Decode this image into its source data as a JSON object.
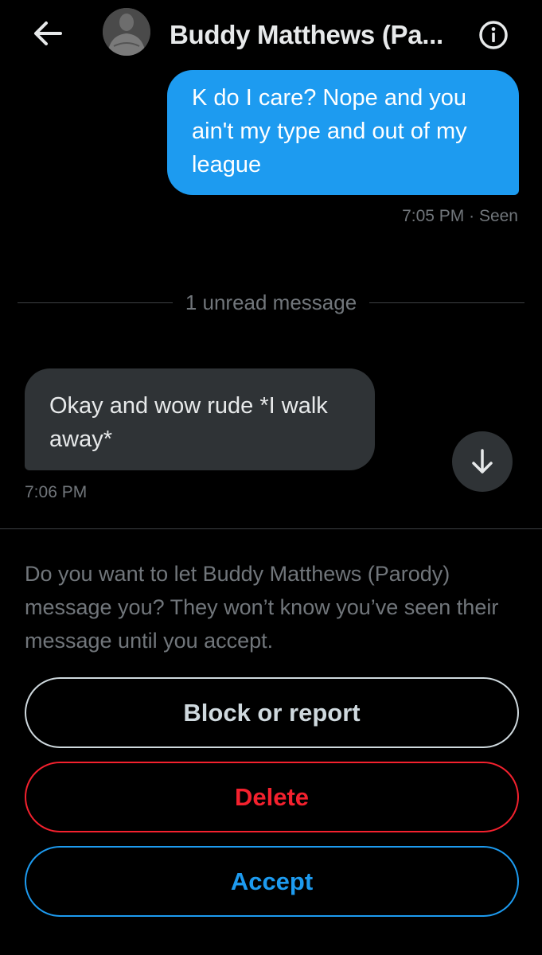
{
  "header": {
    "back_icon": "arrow-left-icon",
    "contact_name": "Buddy Matthews (Pa...",
    "info_icon": "info-circle-icon"
  },
  "messages": {
    "outgoing": {
      "text": "K do I care? Nope and you ain't my type and out of my league",
      "meta": "7:05 PM · Seen"
    },
    "unread_divider": "1 unread message",
    "incoming": {
      "text": "Okay and wow rude *I walk away*",
      "meta": "7:06 PM"
    },
    "scroll_icon": "arrow-down-icon"
  },
  "request": {
    "prompt": "Do you want to let Buddy Matthews (Parody) message you? They won’t know you’ve seen their message until you accept.",
    "block_label": "Block or report",
    "delete_label": "Delete",
    "accept_label": "Accept"
  },
  "colors": {
    "accent": "#1d9bf0",
    "danger": "#f4212e",
    "background": "#000000",
    "incoming_bubble": "#2f3336"
  }
}
